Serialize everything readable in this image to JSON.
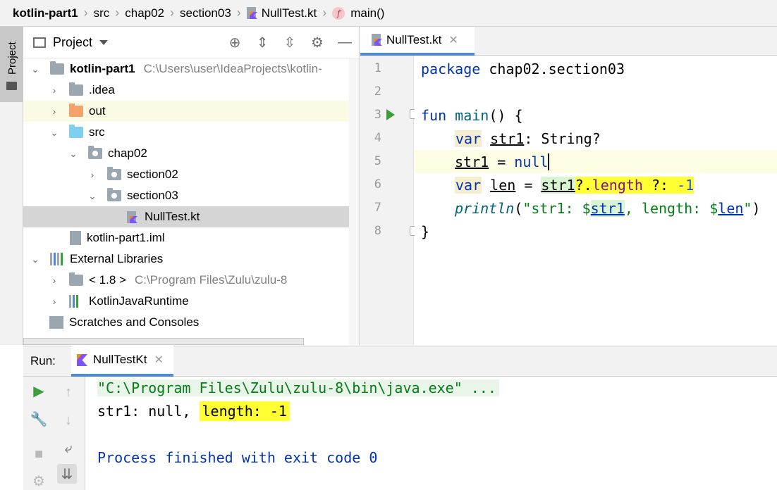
{
  "breadcrumb": {
    "project": "kotlin-part1",
    "items": [
      "src",
      "chap02",
      "section03",
      "NullTest.kt",
      "main()"
    ],
    "fn_badge": "f"
  },
  "tool_stripe": {
    "project_label": "Project"
  },
  "project_panel": {
    "title": "Project",
    "tree": [
      {
        "label": "kotlin-part1",
        "hint": "C:\\Users\\user\\IdeaProjects\\kotlin-",
        "icon": "module-folder-icon"
      },
      {
        "label": ".idea",
        "icon": "folder-icon"
      },
      {
        "label": "out",
        "icon": "excluded-folder-icon"
      },
      {
        "label": "src",
        "icon": "source-folder-icon"
      },
      {
        "label": "chap02",
        "icon": "package-icon"
      },
      {
        "label": "section02",
        "icon": "package-icon"
      },
      {
        "label": "section03",
        "icon": "package-icon"
      },
      {
        "label": "NullTest.kt",
        "icon": "kotlin-file-icon"
      },
      {
        "label": "kotlin-part1.iml",
        "icon": "iml-file-icon"
      },
      {
        "label": "External Libraries",
        "icon": "libraries-icon"
      },
      {
        "label": "< 1.8 >",
        "hint": "C:\\Program Files\\Zulu\\zulu-8",
        "icon": "jdk-icon"
      },
      {
        "label": "KotlinJavaRuntime",
        "icon": "library-icon"
      },
      {
        "label": "Scratches and Consoles",
        "icon": "scratches-icon"
      }
    ]
  },
  "editor": {
    "tab_label": "NullTest.kt",
    "line_numbers": [
      "1",
      "2",
      "3",
      "4",
      "5",
      "6",
      "7",
      "8"
    ],
    "code": {
      "l1_kw": "package",
      "l1_rest": " chap02.section03",
      "l3_kw": "fun",
      "l3_fn": "main",
      "l3_rest": "() {",
      "l4_kw": "var",
      "l4_name": "str1",
      "l4_rest": ": String?",
      "l5_name": "str1",
      "l5_eq": " = ",
      "l5_null": "null",
      "l6_kw": "var",
      "l6_name": "len",
      "l6_eq": " = ",
      "l6_ref": "str1",
      "l6_op": "?.",
      "l6_prop": "length",
      "l6_elvis": " ?: ",
      "l6_num": "-1",
      "l7_fn": "println",
      "l7_open": "(",
      "l7_str1": "\"str1: $",
      "l7_ref1": "str1",
      "l7_str2": ", length: $",
      "l7_ref2": "len",
      "l7_str3": "\"",
      "l7_close": ")",
      "l8": "}"
    }
  },
  "run": {
    "label": "Run:",
    "tab_label": "NullTestKt",
    "console": {
      "cmd": "\"C:\\Program Files\\Zulu\\zulu-8\\bin\\java.exe\" ...",
      "out_prefix": "str1: null, ",
      "out_highlight": "length: -1",
      "exit": "Process finished with exit code 0"
    }
  },
  "colors": {
    "keyword": "#0033b3",
    "string": "#067d17",
    "number": "#1750eb",
    "highlight": "#ffff33",
    "accent": "#4a89dc"
  }
}
